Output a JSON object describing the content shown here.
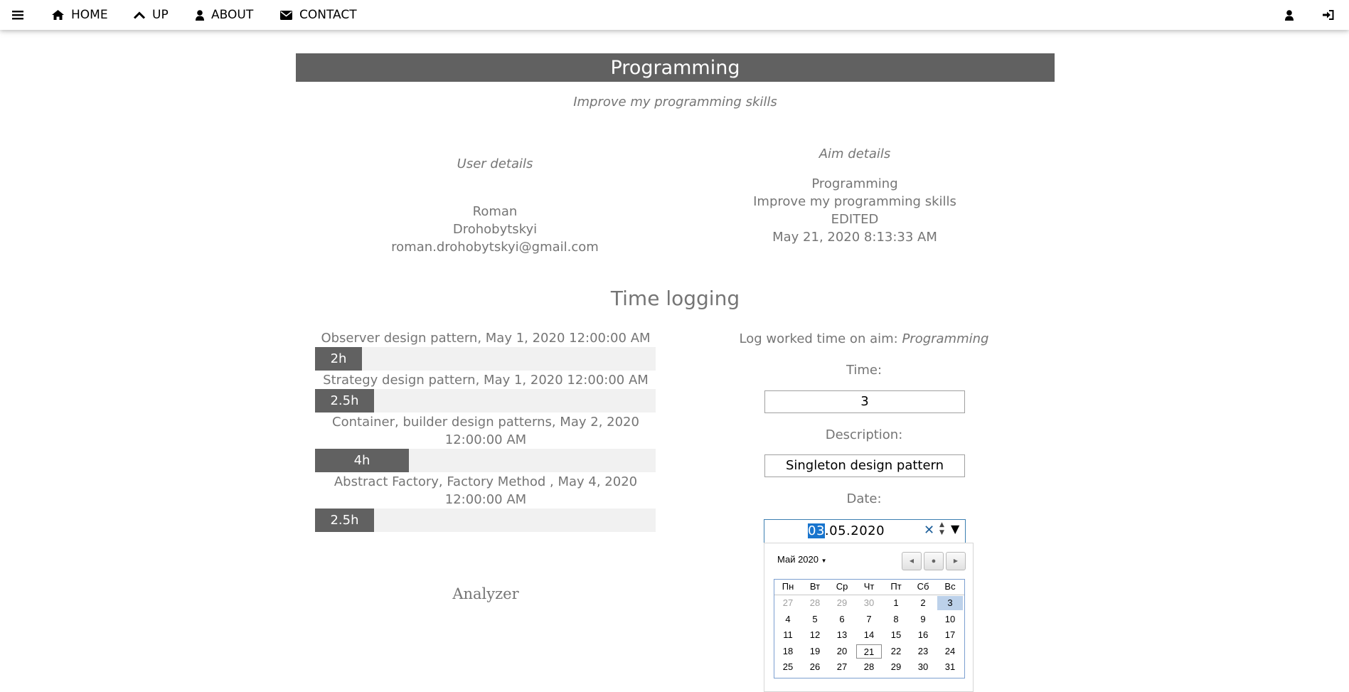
{
  "nav": {
    "home": "HOME",
    "up": "UP",
    "about": "ABOUT",
    "contact": "CONTACT"
  },
  "aim": {
    "title": "Programming",
    "subtitle": "Improve my programming skills"
  },
  "user_details": {
    "label": "User details",
    "first_name": "Roman",
    "last_name": "Drohobytskyi",
    "email": "roman.drohobytskyi@gmail.com"
  },
  "aim_details": {
    "label": "Aim details",
    "name": "Programming",
    "description": "Improve my programming skills",
    "status": "EDITED",
    "date": "May 21, 2020 8:13:33 AM"
  },
  "time_logging": {
    "heading": "Time logging",
    "logs": [
      {
        "title": "Observer design pattern, May 1, 2020 12:00:00 AM",
        "hours_label": "2h",
        "hours": 2
      },
      {
        "title": "Strategy design pattern, May 1, 2020 12:00:00 AM",
        "hours_label": "2.5h",
        "hours": 2.5
      },
      {
        "title_line1": "Container, builder design patterns, May 2, 2020",
        "title_line2": "12:00:00 AM",
        "hours_label": "4h",
        "hours": 4
      },
      {
        "title_line1": "Abstract Factory, Factory Method , May 4, 2020",
        "title_line2": "12:00:00 AM",
        "hours_label": "2.5h",
        "hours": 2.5
      }
    ]
  },
  "analyzer": {
    "heading": "Analyzer"
  },
  "log_form": {
    "prefix": "Log worked time on aim: ",
    "aim_name": "Programming",
    "time_label": "Time:",
    "time_value": "3",
    "description_label": "Description:",
    "description_value": "Singleton design pattern",
    "date_label": "Date:",
    "date_day": "03",
    "date_rest": ".05.2020"
  },
  "calendar": {
    "month_label": "Май 2020",
    "weekdays": [
      "Пн",
      "Вт",
      "Ср",
      "Чт",
      "Пт",
      "Сб",
      "Вс"
    ],
    "weeks": [
      [
        "27",
        "28",
        "29",
        "30",
        "1",
        "2",
        "3"
      ],
      [
        "4",
        "5",
        "6",
        "7",
        "8",
        "9",
        "10"
      ],
      [
        "11",
        "12",
        "13",
        "14",
        "15",
        "16",
        "17"
      ],
      [
        "18",
        "19",
        "20",
        "21",
        "22",
        "23",
        "24"
      ],
      [
        "25",
        "26",
        "27",
        "28",
        "29",
        "30",
        "31"
      ]
    ],
    "selected_day": "3",
    "today": "21"
  },
  "colors": {
    "dark_gray": "#616161",
    "text_gray": "#757575",
    "track": "#f1f1f1",
    "selection_blue": "#1874cd"
  }
}
